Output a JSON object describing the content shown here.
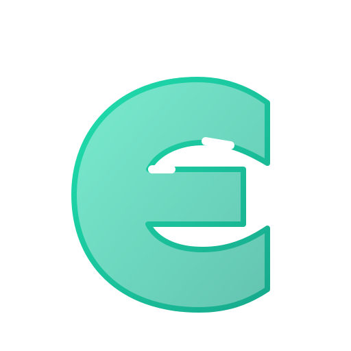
{
  "logo": {
    "icon": "letter-e-glyph-icon",
    "fill_start": "#79ECCF",
    "fill_end": "#63C4B0",
    "stroke_start": "#1FDFAE",
    "stroke_end": "#17A98C"
  }
}
